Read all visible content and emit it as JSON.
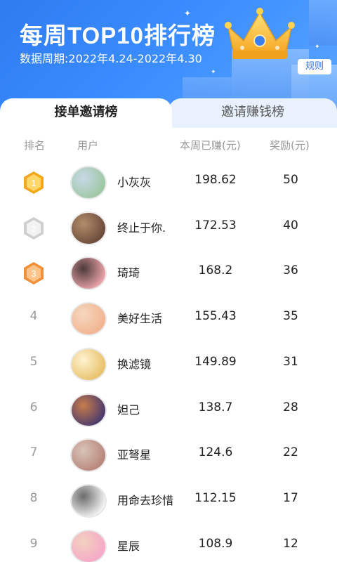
{
  "header": {
    "title": "每周TOP10排行榜",
    "period": "数据周期:2022年4.24-2022年4.30",
    "rule_label": "规则",
    "crown_icon": "crown-icon",
    "accent": "#2f7bf0"
  },
  "tabs": [
    {
      "label": "接单邀请榜",
      "active": true
    },
    {
      "label": "邀请赚钱榜",
      "active": false
    }
  ],
  "columns": {
    "rank": "排名",
    "user": "用户",
    "earned": "本周已赚(元)",
    "reward": "奖励(元)"
  },
  "rows": [
    {
      "rank": "1",
      "medal": "gold",
      "name": "小灰灰",
      "earned": "198.62",
      "reward": "50",
      "avatar_colors": [
        "#9cc7a2",
        "#c9d9e8"
      ]
    },
    {
      "rank": "2",
      "medal": "silver",
      "name": "终止于你.",
      "earned": "172.53",
      "reward": "40",
      "avatar_colors": [
        "#6b4a3a",
        "#b38d6b"
      ]
    },
    {
      "rank": "3",
      "medal": "bronze",
      "name": "琦琦",
      "earned": "168.2",
      "reward": "36",
      "avatar_colors": [
        "#e9a3a8",
        "#4d3a3a"
      ]
    },
    {
      "rank": "4",
      "medal": "",
      "name": "美好生活",
      "earned": "155.43",
      "reward": "35",
      "avatar_colors": [
        "#f2b48f",
        "#f6d7c0"
      ]
    },
    {
      "rank": "5",
      "medal": "",
      "name": "换滤镜",
      "earned": "149.89",
      "reward": "31",
      "avatar_colors": [
        "#e8c16a",
        "#fff3d1"
      ]
    },
    {
      "rank": "6",
      "medal": "",
      "name": "妲己",
      "earned": "138.7",
      "reward": "28",
      "avatar_colors": [
        "#4a3a6e",
        "#c77c4a"
      ]
    },
    {
      "rank": "7",
      "medal": "",
      "name": "亚弩星",
      "earned": "124.6",
      "reward": "22",
      "avatar_colors": [
        "#b8857a",
        "#d9c4b8"
      ]
    },
    {
      "rank": "8",
      "medal": "",
      "name": "用命去珍惜",
      "earned": "112.15",
      "reward": "17",
      "avatar_colors": [
        "#f2f2f2",
        "#6b6b6b"
      ]
    },
    {
      "rank": "9",
      "medal": "",
      "name": "星辰",
      "earned": "108.9",
      "reward": "12",
      "avatar_colors": [
        "#f5a8c8",
        "#f3d2c0"
      ]
    }
  ]
}
